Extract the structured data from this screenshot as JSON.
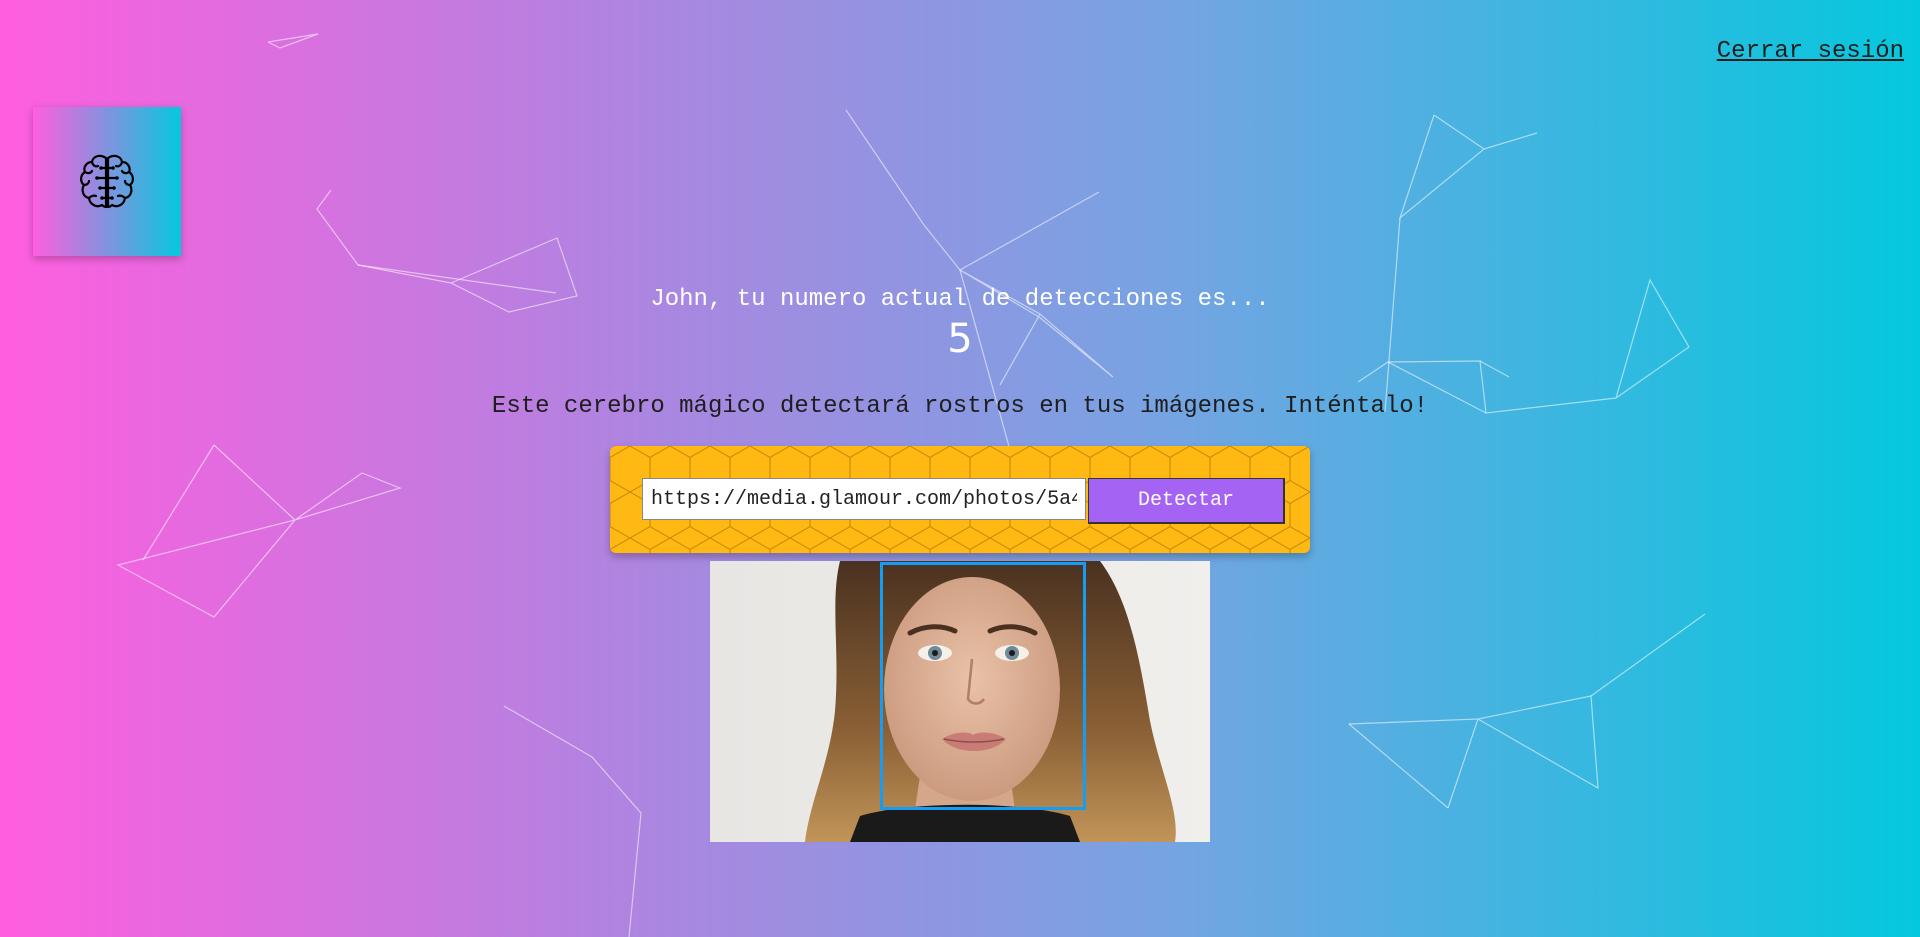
{
  "header": {
    "signout_label": "Cerrar sesión"
  },
  "logo": {
    "icon": "brain-icon"
  },
  "rank": {
    "text": "John, tu numero actual de detecciones es...",
    "count": "5"
  },
  "tagline": "Este cerebro mágico detectará rostros en tus imágenes. Inténtalo!",
  "form": {
    "url_value": "https://media.glamour.com/photos/5a4",
    "detect_label": "Detectar"
  },
  "colors": {
    "gradient_start": "#ff5edf",
    "gradient_end": "#04c8de",
    "form_background": "#ffb912",
    "button": "#a463f2",
    "face_box": "#149df2"
  }
}
